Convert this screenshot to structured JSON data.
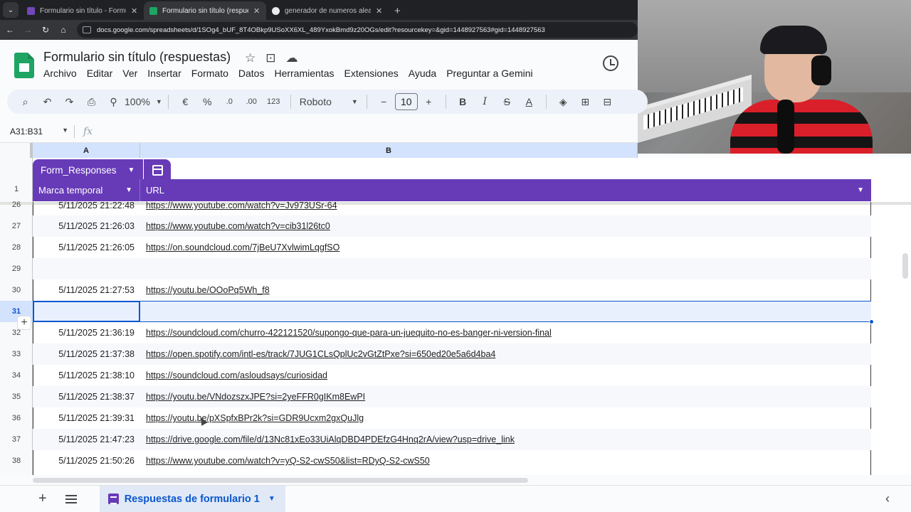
{
  "browser": {
    "tabs": [
      {
        "title": "Formulario sin título - Formular",
        "favicon_color": "#7248b9",
        "active": false
      },
      {
        "title": "Formulario sin título (respuesta",
        "favicon_color": "#1fa463",
        "active": true
      },
      {
        "title": "generador de numeros aleatori",
        "favicon_color": "#e8eaed",
        "active": false
      }
    ],
    "url": "docs.google.com/spreadsheets/d/1SOg4_bUF_8T4OBkp9USoXX6XL_489YxokBmd9z20OGs/edit?resourcekey=&gid=1448927563#gid=1448927563"
  },
  "doc": {
    "title": "Formulario sin título (respuestas)",
    "menu": [
      "Archivo",
      "Editar",
      "Ver",
      "Insertar",
      "Formato",
      "Datos",
      "Herramientas",
      "Extensiones",
      "Ayuda",
      "Preguntar a Gemini"
    ]
  },
  "toolbar": {
    "zoom": "100%",
    "currency": "€",
    "percent": "%",
    "dec_decrease": ".0",
    "dec_increase": ".00",
    "format_number": "123",
    "font": "Roboto",
    "font_size": "10",
    "minus": "−",
    "plus": "+",
    "bold": "B",
    "italic": "I",
    "strike": "S",
    "text_color": "A"
  },
  "formula_bar": {
    "name_box": "A31:B31",
    "fx": "fx"
  },
  "columns": {
    "a": "A",
    "b": "B"
  },
  "table": {
    "name": "Form_Responses",
    "headers": {
      "a": "Marca temporal",
      "b": "URL"
    },
    "header_row_number": "1",
    "rows": [
      {
        "num": "26",
        "a": "5/11/2025 21:22:48",
        "b": "https://www.youtube.com/watch?v=Jv973USr-64"
      },
      {
        "num": "27",
        "a": "5/11/2025 21:26:03",
        "b": "https://www.youtube.com/watch?v=cib31l26tc0"
      },
      {
        "num": "28",
        "a": "5/11/2025 21:26:05",
        "b": "https://on.soundcloud.com/7jBeU7XvlwimLqgfSO"
      },
      {
        "num": "29",
        "a": "",
        "b": ""
      },
      {
        "num": "30",
        "a": "5/11/2025 21:27:53",
        "b": "https://youtu.be/OOoPq5Wh_f8"
      },
      {
        "num": "31",
        "a": "",
        "b": ""
      },
      {
        "num": "32",
        "a": "5/11/2025 21:36:19",
        "b": "https://soundcloud.com/churro-422121520/supongo-que-para-un-juequito-no-es-banger-ni-version-final"
      },
      {
        "num": "33",
        "a": "5/11/2025 21:37:38",
        "b": "https://open.spotify.com/intl-es/track/7JUG1CLsQplUc2vGtZtPxe?si=650ed20e5a6d4ba4"
      },
      {
        "num": "34",
        "a": "5/11/2025 21:38:10",
        "b": "https://soundcloud.com/asloudsays/curiosidad"
      },
      {
        "num": "35",
        "a": "5/11/2025 21:38:37",
        "b": "https://youtu.be/VNdozszxJPE?si=2yeFFR0gIKm8EwPI"
      },
      {
        "num": "36",
        "a": "5/11/2025 21:39:31",
        "b": "https://youtu.be/pXSpfxBPr2k?si=GDR9Ucxm2gxQuJlg"
      },
      {
        "num": "37",
        "a": "5/11/2025 21:47:23",
        "b": "https://drive.google.com/file/d/13Nc81xEo33UiAlqDBD4PDEfzG4Hnq2rA/view?usp=drive_link"
      },
      {
        "num": "38",
        "a": "5/11/2025 21:50:26",
        "b": "https://www.youtube.com/watch?v=yQ-S2-cwS50&list=RDyQ-S2-cwS50"
      }
    ],
    "selected_row": "31"
  },
  "sheet_tabs": {
    "active": "Respuestas de formulario 1"
  },
  "colors": {
    "table_header": "#673ab7",
    "selection": "#0b57d0"
  }
}
